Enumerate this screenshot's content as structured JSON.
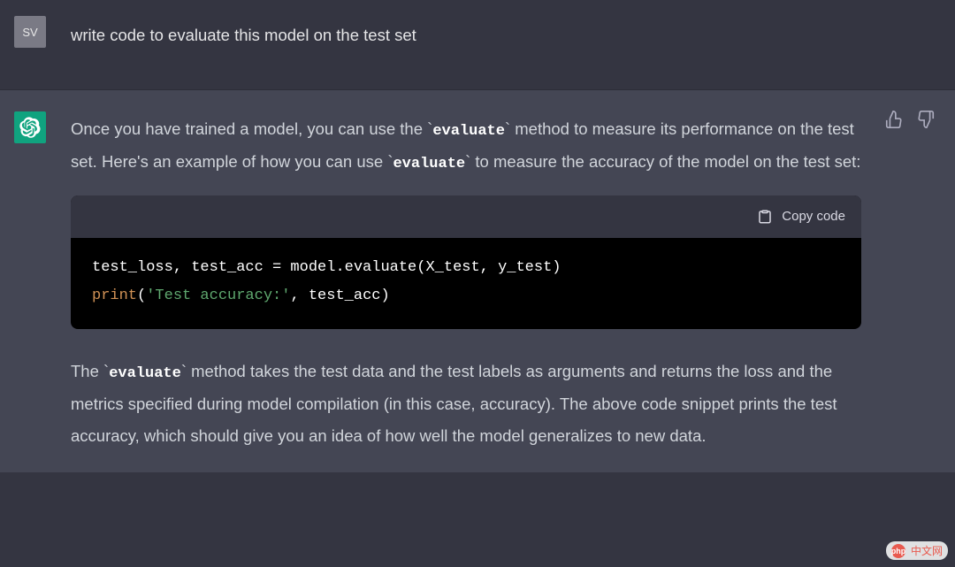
{
  "user": {
    "avatar_initials": "SV",
    "message": "write code to evaluate this model on the test set"
  },
  "assistant": {
    "para1_a": "Once you have trained a model, you can use the ",
    "para1_code1": "evaluate",
    "para1_b": " method to measure its performance on the test set. Here's an example of how you can use ",
    "para1_code2": "evaluate",
    "para1_c": " to measure the accuracy of the model on the test set:",
    "copy_label": "Copy code",
    "code": {
      "line1_a": "test_loss, test_acc = model.evaluate(X_test, y_test)",
      "line2_fn": "print",
      "line2_paren_open": "(",
      "line2_str": "'Test accuracy:'",
      "line2_rest": ", test_acc)"
    },
    "para2_a": "The ",
    "para2_code1": "evaluate",
    "para2_b": " method takes the test data and the test labels as arguments and returns the loss and the metrics specified during model compilation (in this case, accuracy). The above code snippet prints the test accuracy, which should give you an idea of how well the model generalizes to new data."
  },
  "watermark": {
    "badge": "php",
    "text": "中文网"
  }
}
